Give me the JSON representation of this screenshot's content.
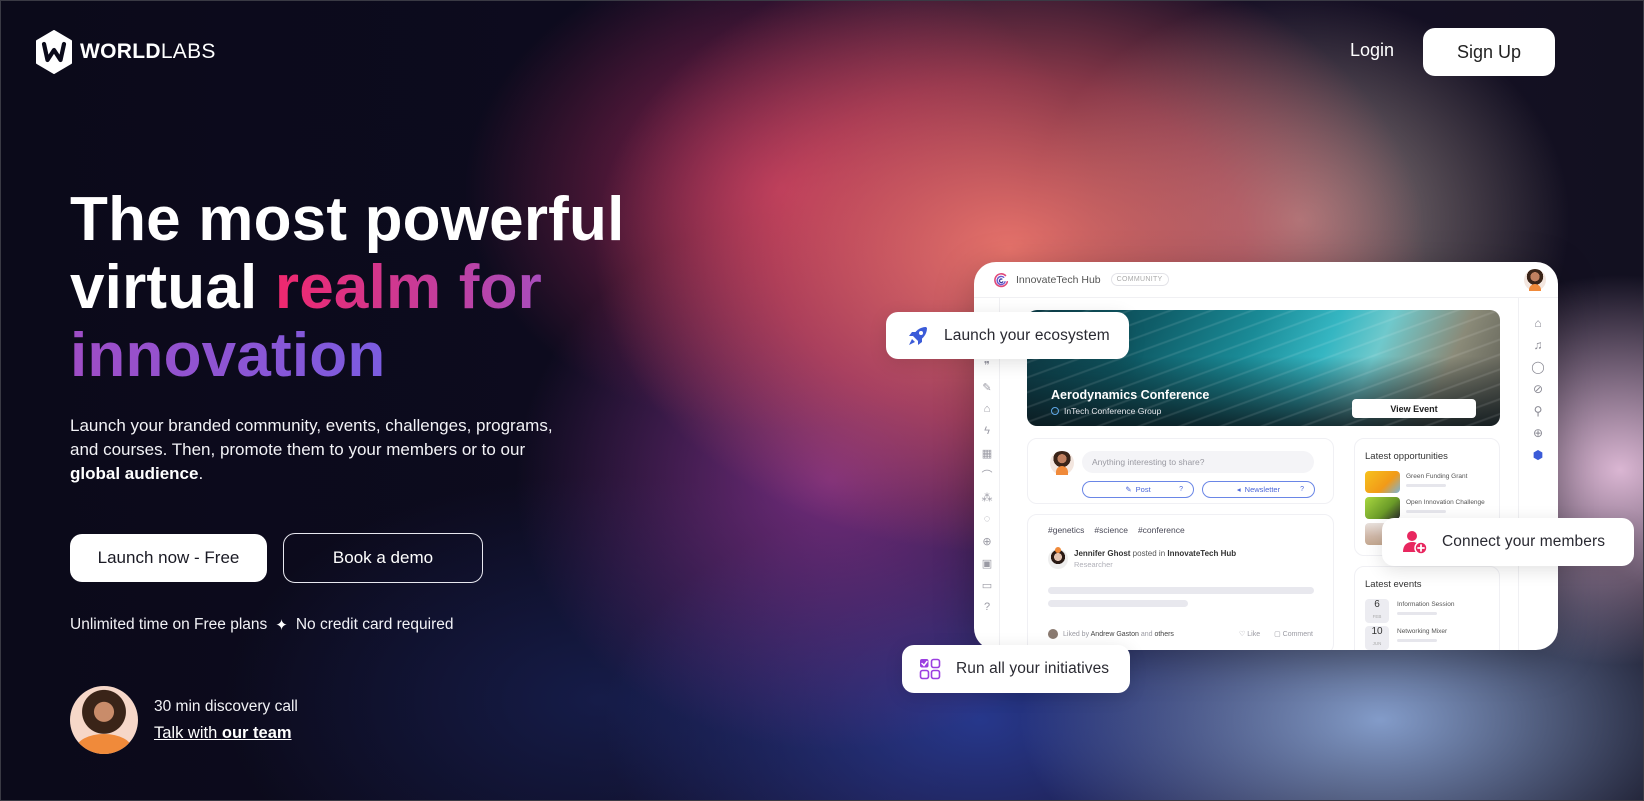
{
  "brand": {
    "name_bold": "WORLD",
    "name_light": "LABS"
  },
  "nav": {
    "login": "Login",
    "signup": "Sign Up"
  },
  "hero": {
    "headline_line1": "The most powerful",
    "headline_line2_plain": "virtual ",
    "headline_line2_accent": "realm for",
    "headline_line3_accent": "innovation",
    "subtitle_part1": "Launch your branded community, events, challenges, programs, and courses. Then, promote them to your members or to our ",
    "subtitle_bold": "global audience",
    "subtitle_part2": ".",
    "cta_primary": "Launch now - Free",
    "cta_secondary": "Book a demo",
    "perk1": "Unlimited time on Free plans",
    "perk_separator": "✦",
    "perk2": "No credit card required",
    "discovery_label": "30 min discovery call",
    "talk_prefix": "Talk with ",
    "talk_bold": "our team"
  },
  "mockup": {
    "community_name": "InnovateTech Hub",
    "community_badge": "COMMUNITY",
    "banner": {
      "title": "Aerodynamics Conference",
      "group": "InTech Conference Group",
      "button": "View Event"
    },
    "composer": {
      "placeholder": "Anything interesting to share?",
      "post_label": "Post",
      "newsletter_label": "Newsletter",
      "help_glyph": "?"
    },
    "feed": {
      "tags": [
        "#genetics",
        "#science",
        "#conference"
      ],
      "author": "Jennifer Ghost",
      "posted_in": " posted in ",
      "community": "InnovateTech Hub",
      "role": "Researcher",
      "liked_by_prefix": "Liked by ",
      "liked_by_name": "Andrew Gaston",
      "liked_by_mid": " and ",
      "liked_by_suffix": "others",
      "like_label": "Like",
      "comment_label": "Comment"
    },
    "opportunities": {
      "title": "Latest opportunities",
      "items": [
        {
          "name": "Green Funding Grant",
          "color": "#f2b51c"
        },
        {
          "name": "Open Innovation Challenge",
          "color": "#8cc43a"
        },
        {
          "name": "",
          "color": "#d9c0ae"
        }
      ]
    },
    "events": {
      "title": "Latest events",
      "items": [
        {
          "day": "6",
          "month": "FEB",
          "name": "Information Session"
        },
        {
          "day": "10",
          "month": "JUN",
          "name": "Networking Mixer"
        }
      ]
    },
    "left_nav_icons": [
      "quote-icon",
      "edit-icon",
      "store-icon",
      "lightning-icon",
      "calendar-icon",
      "graduation-icon",
      "group-icon",
      "focus-icon",
      "search-user-icon",
      "image-icon",
      "folder-icon",
      "help-icon"
    ],
    "right_nav_icons": [
      "home-icon",
      "bell-icon",
      "chat-icon",
      "compass-icon",
      "search-icon",
      "plus-icon",
      "worldlabs-icon"
    ]
  },
  "callouts": {
    "launch": "Launch your ecosystem",
    "connect": "Connect your members",
    "run": "Run all your initiatives"
  },
  "colors": {
    "accent_pink": "#f0286e",
    "accent_purple": "#7b5ce0",
    "rocket_blue": "#3b5bd8",
    "connect_pink": "#e8275f",
    "run_purple": "#9b3fe0"
  }
}
